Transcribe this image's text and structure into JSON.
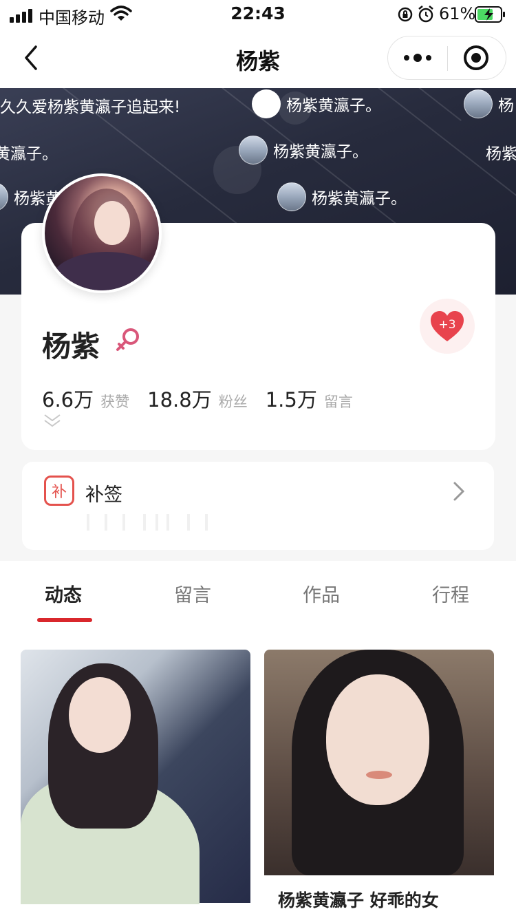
{
  "status_bar": {
    "carrier": "中国移动",
    "time": "22:43",
    "battery_percent": "61%"
  },
  "nav": {
    "title": "杨紫"
  },
  "banner": {
    "danmaku": [
      "久久爱杨紫黄瀛子追起来!",
      "杨紫黄瀛子。",
      "杨",
      "黄瀛子。",
      "杨紫黄瀛子。",
      "杨紫",
      "杨紫黄",
      "杨紫黄瀛子。"
    ]
  },
  "profile": {
    "name": "杨紫",
    "gender_icon": "female-icon",
    "heart_badge": "+3",
    "stats": [
      {
        "value": "6.6万",
        "label": "获赞"
      },
      {
        "value": "18.8万",
        "label": "粉丝"
      },
      {
        "value": "1.5万",
        "label": "留言"
      }
    ]
  },
  "sign": {
    "icon_text": "补",
    "label": "补签"
  },
  "tabs": [
    {
      "label": "动态",
      "active": true
    },
    {
      "label": "留言",
      "active": false
    },
    {
      "label": "作品",
      "active": false
    },
    {
      "label": "行程",
      "active": false
    }
  ],
  "posts": [
    {
      "caption": ""
    },
    {
      "caption": "杨紫黄瀛子 好乖的女"
    }
  ],
  "colors": {
    "accent": "#d9272c",
    "sign_icon": "#e4524d",
    "female_icon": "#d9577a",
    "banner_bg": "#272b3d"
  }
}
